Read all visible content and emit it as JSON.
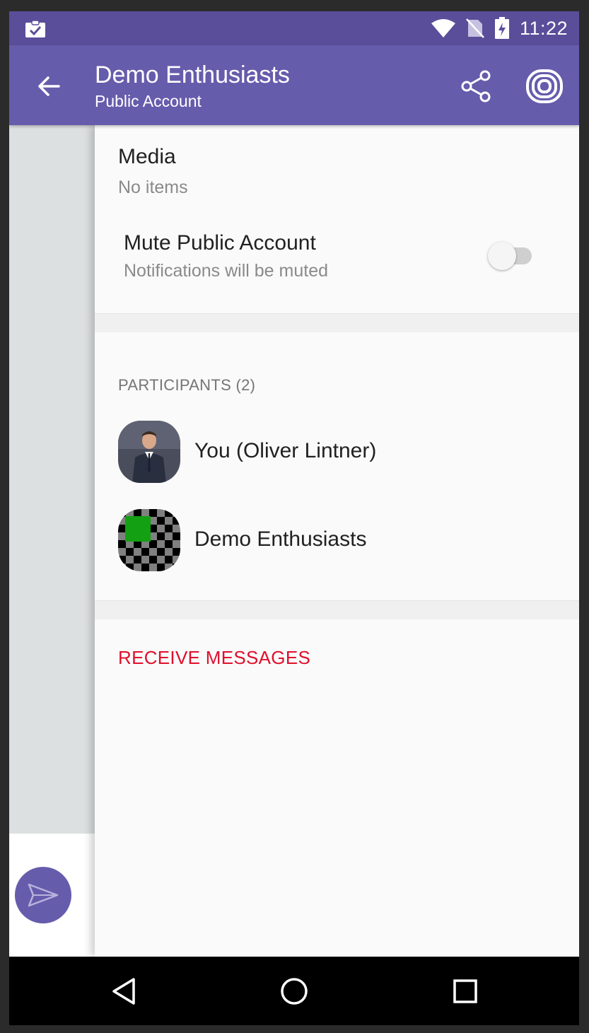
{
  "status_bar": {
    "time": "11:22",
    "icons": [
      "clipboard-check-icon",
      "wifi-icon",
      "no-sim-icon",
      "battery-charging-icon"
    ]
  },
  "toolbar": {
    "title": "Demo Enthusiasts",
    "subtitle": "Public Account",
    "icons": [
      "back-arrow-icon",
      "share-icon",
      "rakuten-icon"
    ]
  },
  "media": {
    "title": "Media",
    "subtitle": "No items"
  },
  "mute": {
    "title": "Mute Public Account",
    "subtitle": "Notifications will be muted",
    "enabled": false
  },
  "participants": {
    "header": "PARTICIPANTS (2)",
    "items": [
      {
        "name": "You (Oliver Lintner)",
        "avatar": "person-photo"
      },
      {
        "name": "Demo Enthusiasts",
        "avatar": "checkerboard-logo"
      }
    ]
  },
  "receive_messages": {
    "label": "RECEIVE MESSAGES"
  },
  "colors": {
    "status_bar": "#5a4e9a",
    "toolbar": "#665cac",
    "accent_red": "#e0102c"
  }
}
